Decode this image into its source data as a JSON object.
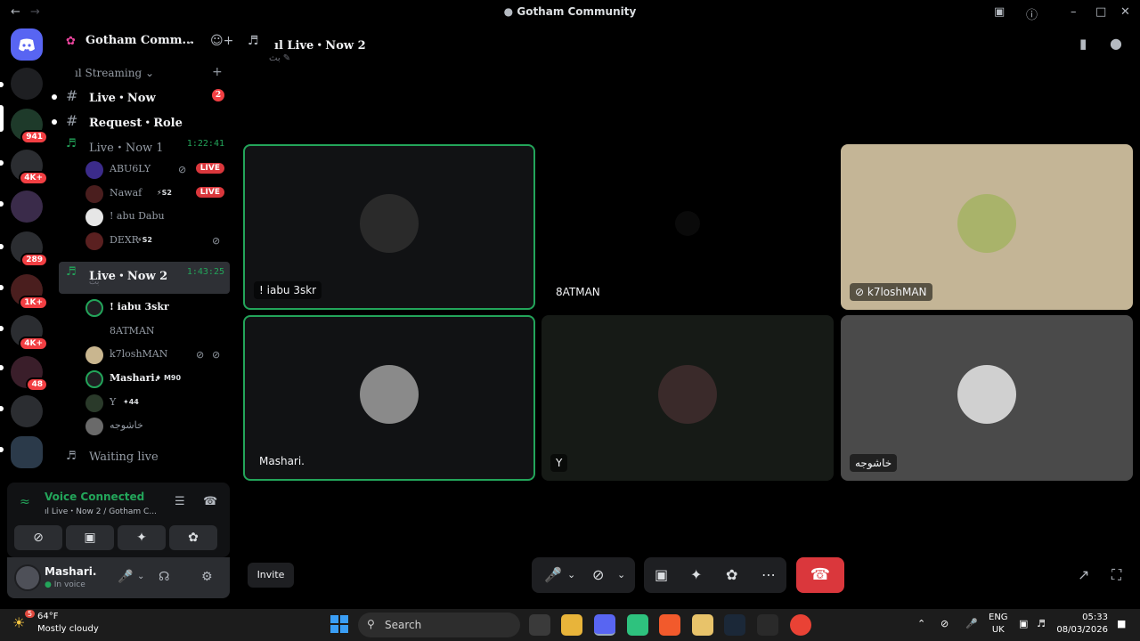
{
  "window": {
    "title": "Gotham Community"
  },
  "server_rail": {
    "badges": [
      "941",
      "4K+",
      "289",
      "1K+",
      "4K+",
      "48"
    ]
  },
  "guild": {
    "name": "Gotham Comm..."
  },
  "category": {
    "label": "Streaming"
  },
  "channels": [
    {
      "name": "Live・Now",
      "count": "2"
    },
    {
      "name": "Request・Role"
    },
    {
      "name": "Live・Now 1",
      "timer": "1:22:41"
    },
    {
      "name": "Live・Now 2",
      "timer": "1:43:25",
      "sub": "بث"
    },
    {
      "name": "Waiting live"
    }
  ],
  "live_now_1_members": [
    {
      "name": "ABU6LY",
      "live": "LIVE"
    },
    {
      "name": "Nawaf",
      "tag": "S2",
      "live": "LIVE"
    },
    {
      "name": "! abu Dabu"
    },
    {
      "name": "DEXR",
      "tag": "S2"
    }
  ],
  "live_now_2_members": [
    {
      "name": "! iabu 3skr"
    },
    {
      "name": "8ATMAN"
    },
    {
      "name": "k7loshMAN"
    },
    {
      "name": "Mashari.",
      "tag": "M90"
    },
    {
      "name": "Y",
      "tag": "44"
    },
    {
      "name": "خاشوجه"
    }
  ],
  "voice_panel": {
    "status": "Voice Connected",
    "channel": "Live・Now 2 / Gotham C..."
  },
  "user": {
    "name": "Mashari.",
    "status": "In voice"
  },
  "stage": {
    "title": "Live・Now 2",
    "subtitle": "بث",
    "tiles": [
      {
        "name": "! iabu 3skr"
      },
      {
        "name": "8ATMAN"
      },
      {
        "name": "k7loshMAN"
      },
      {
        "name": "Mashari."
      },
      {
        "name": "Y"
      },
      {
        "name": "خاشوجه"
      }
    ],
    "invite_label": "Invite"
  },
  "taskbar": {
    "weather_temp": "64°F",
    "weather_desc": "Mostly cloudy",
    "weather_badge": "5",
    "search_label": "Search",
    "lang_top": "ENG",
    "lang_bottom": "UK",
    "time": "05:33",
    "date": "08/03/2026"
  },
  "colors": {
    "accent_green": "#23a55a",
    "danger_red": "#da373c",
    "badge_red": "#f23f43"
  }
}
